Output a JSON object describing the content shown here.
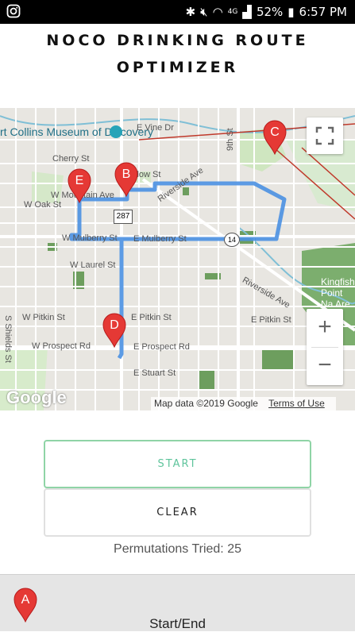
{
  "status_bar": {
    "battery_percent": "52%",
    "time": "6:57 PM",
    "network": "4G",
    "icons": [
      "instagram-icon",
      "bluetooth-icon",
      "mute-icon",
      "wifi-icon",
      "signal-icon",
      "battery-icon"
    ]
  },
  "app": {
    "title": "NOCO DRINKING ROUTE OPTIMIZER"
  },
  "map": {
    "poi_label": "rt Collins Museum of Discovery",
    "street_labels": {
      "vine": "E Vine Dr",
      "cherry": "Cherry St",
      "mountain": "W Mountain Ave",
      "oak": "W Oak St",
      "mulberry_w": "W Mulberry St",
      "mulberry_e": "E Mulberry St",
      "laurel": "W Laurel St",
      "pitkin_w": "W Pitkin St",
      "pitkin_e": "E Pitkin St",
      "pitkin_e2": "E Pitkin St",
      "prospect_w": "W Prospect Rd",
      "prospect_e": "E Prospect Rd",
      "stuart": "E Stuart St",
      "riverside": "Riverside Ave",
      "riverside2": "Riverside Ave",
      "ninth": "9th St",
      "shields": "S Shields St",
      "kingfisher": "Kingfishe Point Na Are",
      "willow": "llow St"
    },
    "highway_shields": [
      "287",
      "14"
    ],
    "markers": [
      "A",
      "B",
      "C",
      "D",
      "E"
    ],
    "marker_color": "#e53935",
    "route_color": "#4a90e2",
    "attribution": "Map data ©2019 Google",
    "terms": "Terms of Use",
    "logo": "Google"
  },
  "controls": {
    "start_label": "START",
    "clear_label": "CLEAR",
    "permutations_label": "Permutations Tried: 25",
    "accent_color": "#5fc49c"
  },
  "stops": [
    {
      "marker": "A",
      "label": "Start/End"
    }
  ]
}
